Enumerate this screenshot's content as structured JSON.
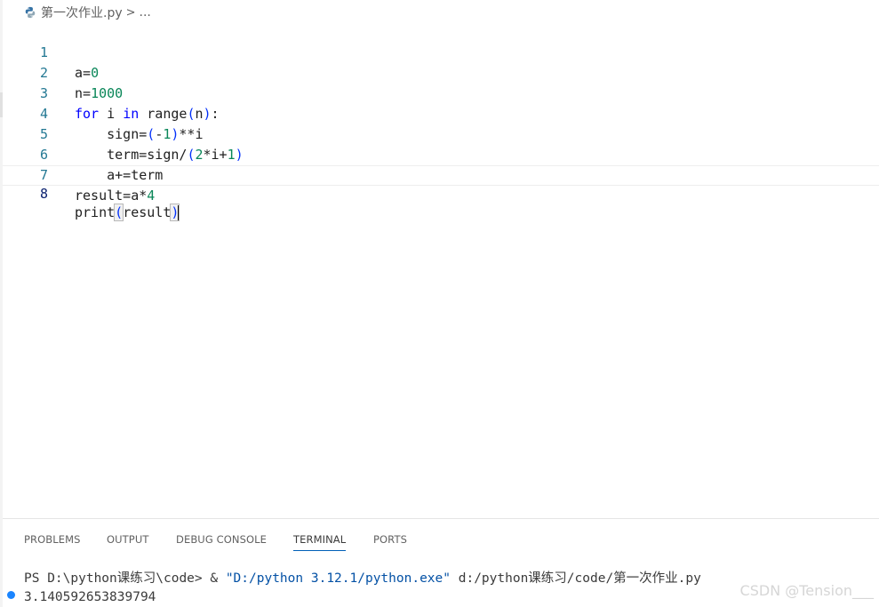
{
  "breadcrumb": {
    "file_name": "第一次作业.py",
    "separator": ">",
    "ellipsis": "..."
  },
  "editor": {
    "lines": [
      {
        "number": "1",
        "text": "a=0"
      },
      {
        "number": "2",
        "text": "n=1000"
      },
      {
        "number": "3",
        "text": "for i in range(n):"
      },
      {
        "number": "4",
        "text": "    sign=(-1)**i"
      },
      {
        "number": "5",
        "text": "    term=sign/(2*i+1)"
      },
      {
        "number": "6",
        "text": "    a+=term"
      },
      {
        "number": "7",
        "text": "result=a*4"
      },
      {
        "number": "8",
        "text": "print(result)"
      }
    ],
    "tokens": {
      "l1": [
        "a=",
        "0"
      ],
      "l2": [
        "n=",
        "1000"
      ],
      "l3": [
        "for",
        " i ",
        "in",
        " range",
        "(",
        "n",
        ")",
        ":"
      ],
      "l4": [
        "    sign=",
        "(",
        "-",
        "1",
        ")",
        "**i"
      ],
      "l5": [
        "    term=sign/",
        "(",
        "2",
        "*i+",
        "1",
        ")"
      ],
      "l6": [
        "    a+=term"
      ],
      "l7": [
        "result=a*",
        "4"
      ],
      "l8": [
        "print",
        "(",
        "result",
        ")"
      ]
    }
  },
  "panel": {
    "tabs": [
      "PROBLEMS",
      "OUTPUT",
      "DEBUG CONSOLE",
      "TERMINAL",
      "PORTS"
    ],
    "active_tab": "TERMINAL",
    "terminal": {
      "prompt": "PS D:\\python课练习\\code> & ",
      "exe": "\"D:/python 3.12.1/python.exe\"",
      "script": " d:/python课练习/code/第一次作业.py",
      "output": "3.140592653839794"
    }
  },
  "watermark": "CSDN @Tension___",
  "colors": {
    "keyword": "#0000ff",
    "number": "#098658",
    "bracket1": "#0431fa",
    "bracket2": "#319331",
    "line_number": "#237893",
    "status_dot": "#1a85ff"
  }
}
